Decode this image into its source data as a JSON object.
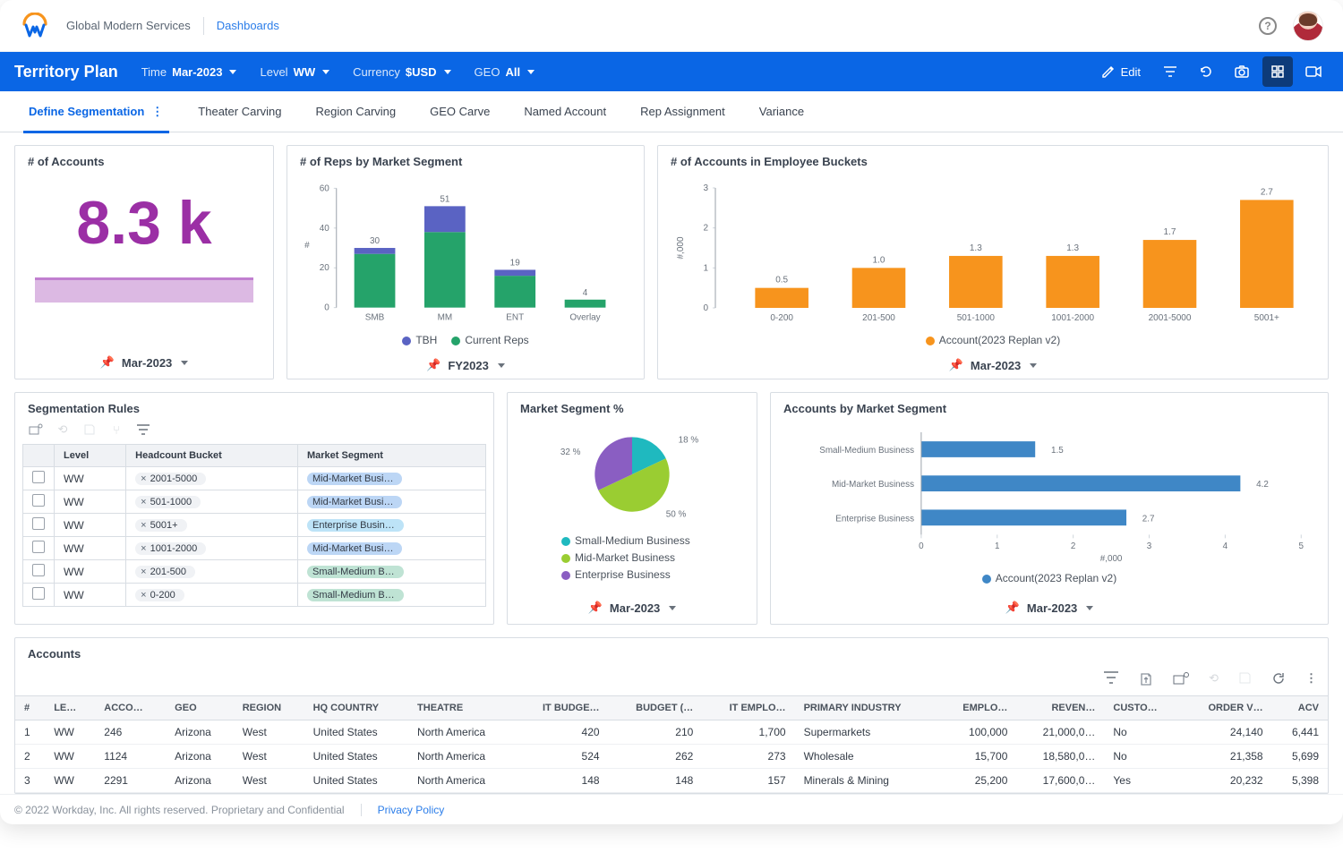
{
  "header": {
    "org": "Global Modern Services",
    "breadcrumb": "Dashboards"
  },
  "bluebar": {
    "title": "Territory Plan",
    "filters": [
      {
        "label": "Time",
        "value": "Mar-2023"
      },
      {
        "label": "Level",
        "value": "WW"
      },
      {
        "label": "Currency",
        "value": "$USD"
      },
      {
        "label": "GEO",
        "value": "All"
      }
    ],
    "edit": "Edit"
  },
  "tabs": [
    "Define Segmentation",
    "Theater Carving",
    "Region Carving",
    "GEO Carve",
    "Named Account",
    "Rep Assignment",
    "Variance"
  ],
  "active_tab": "Define Segmentation",
  "kpi_accounts": {
    "title": "# of Accounts",
    "value": "8.3 k",
    "foot": "Mar-2023"
  },
  "reps_by_segment": {
    "title": "# of Reps by Market Segment",
    "foot": "FY2023",
    "legend": [
      "TBH",
      "Current Reps"
    ]
  },
  "accounts_buckets": {
    "title": "# of Accounts in Employee Buckets",
    "foot": "Mar-2023",
    "legend": "Account(2023 Replan v2)"
  },
  "seg_rules": {
    "title": "Segmentation Rules",
    "cols": [
      "",
      "Level",
      "Headcount Bucket",
      "Market Segment"
    ],
    "rows": [
      {
        "level": "WW",
        "bucket": "2001-5000",
        "segment": "Mid-Market Busi…",
        "seg_class": "mid"
      },
      {
        "level": "WW",
        "bucket": "501-1000",
        "segment": "Mid-Market Busi…",
        "seg_class": "mid"
      },
      {
        "level": "WW",
        "bucket": "5001+",
        "segment": "Enterprise Busin…",
        "seg_class": "ent"
      },
      {
        "level": "WW",
        "bucket": "1001-2000",
        "segment": "Mid-Market Busi…",
        "seg_class": "mid"
      },
      {
        "level": "WW",
        "bucket": "201-500",
        "segment": "Small-Medium B…",
        "seg_class": "smb"
      },
      {
        "level": "WW",
        "bucket": "0-200",
        "segment": "Small-Medium B…",
        "seg_class": "smb"
      }
    ]
  },
  "segment_pct": {
    "title": "Market Segment %",
    "foot": "Mar-2023",
    "legend": [
      "Small-Medium Business",
      "Mid-Market Business",
      "Enterprise Business"
    ]
  },
  "accts_by_segment": {
    "title": "Accounts by Market Segment",
    "foot": "Mar-2023",
    "legend": "Account(2023 Replan v2)"
  },
  "accounts_table": {
    "title": "Accounts",
    "cols": [
      "#",
      "LE…",
      "ACCO…",
      "GEO",
      "REGION",
      "HQ COUNTRY",
      "THEATRE",
      "IT BUDGE…",
      "BUDGET (…",
      "IT EMPLO…",
      "PRIMARY INDUSTRY",
      "EMPLO…",
      "REVEN…",
      "CUSTO…",
      "ORDER V…",
      "ACV"
    ],
    "rows": [
      {
        "n": "1",
        "level": "WW",
        "acct": "246",
        "geo": "Arizona",
        "region": "West",
        "hq": "United States",
        "theatre": "North America",
        "itb": "420",
        "bud": "210",
        "ite": "1,700",
        "ind": "Supermarkets",
        "emp": "100,000",
        "rev": "21,000,0…",
        "cust": "No",
        "ord": "24,140",
        "acv": "6,441"
      },
      {
        "n": "2",
        "level": "WW",
        "acct": "1124",
        "geo": "Arizona",
        "region": "West",
        "hq": "United States",
        "theatre": "North America",
        "itb": "524",
        "bud": "262",
        "ite": "273",
        "ind": "Wholesale",
        "emp": "15,700",
        "rev": "18,580,0…",
        "cust": "No",
        "ord": "21,358",
        "acv": "5,699"
      },
      {
        "n": "3",
        "level": "WW",
        "acct": "2291",
        "geo": "Arizona",
        "region": "West",
        "hq": "United States",
        "theatre": "North America",
        "itb": "148",
        "bud": "148",
        "ite": "157",
        "ind": "Minerals & Mining",
        "emp": "25,200",
        "rev": "17,600,0…",
        "cust": "Yes",
        "ord": "20,232",
        "acv": "5,398"
      }
    ]
  },
  "footer": {
    "copyright": "© 2022 Workday, Inc. All rights reserved. Proprietary and Confidential",
    "privacy": "Privacy Policy"
  },
  "chart_data": [
    {
      "id": "reps_by_segment",
      "type": "bar-stacked",
      "title": "# of Reps by Market Segment",
      "xlabel": "",
      "ylabel": "#",
      "ylim": [
        0,
        60
      ],
      "yticks": [
        0,
        20,
        40,
        60
      ],
      "categories": [
        "SMB",
        "MM",
        "ENT",
        "Overlay"
      ],
      "series": [
        {
          "name": "Current Reps",
          "color": "#25a36a",
          "values": [
            27,
            38,
            16,
            4
          ]
        },
        {
          "name": "TBH",
          "color": "#5a63c3",
          "values": [
            3,
            13,
            3,
            0
          ]
        }
      ],
      "totals": [
        30,
        51,
        19,
        4
      ]
    },
    {
      "id": "accounts_in_buckets",
      "type": "bar",
      "title": "# of Accounts in Employee Buckets",
      "xlabel": "",
      "ylabel": "#,000",
      "ylim": [
        0,
        3
      ],
      "yticks": [
        0,
        1,
        2,
        3
      ],
      "categories": [
        "0-200",
        "201-500",
        "501-1000",
        "1001-2000",
        "2001-5000",
        "5001+"
      ],
      "series": [
        {
          "name": "Account(2023 Replan v2)",
          "color": "#f7941d",
          "values": [
            0.5,
            1.0,
            1.3,
            1.3,
            1.7,
            2.7
          ]
        }
      ]
    },
    {
      "id": "market_segment_pct",
      "type": "pie",
      "title": "Market Segment %",
      "slices": [
        {
          "name": "Small-Medium Business",
          "value": 18,
          "color": "#1fb9bf"
        },
        {
          "name": "Mid-Market Business",
          "value": 50,
          "color": "#9acd32"
        },
        {
          "name": "Enterprise Business",
          "value": 32,
          "color": "#8a5ec2"
        }
      ]
    },
    {
      "id": "accounts_by_segment",
      "type": "bar-horizontal",
      "title": "Accounts by Market Segment",
      "xlabel": "#,000",
      "xlim": [
        0,
        5
      ],
      "xticks": [
        0,
        1,
        2,
        3,
        4,
        5
      ],
      "categories": [
        "Small-Medium Business",
        "Mid-Market Business",
        "Enterprise Business"
      ],
      "series": [
        {
          "name": "Account(2023 Replan v2)",
          "color": "#3f87c6",
          "values": [
            1.5,
            4.2,
            2.7
          ]
        }
      ]
    }
  ]
}
